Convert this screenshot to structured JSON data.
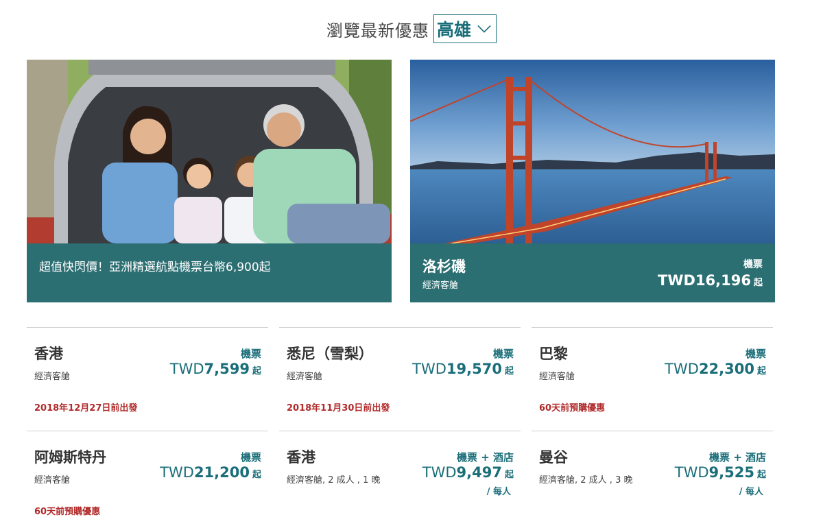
{
  "header": {
    "title": "瀏覽最新優惠",
    "city": "高雄"
  },
  "heroes": [
    {
      "promo": "超值快閃價！亞洲精選航點機票台幣6,900起"
    },
    {
      "destination": "洛杉磯",
      "cabin": "經濟客艙",
      "product": "機票",
      "currency": "TWD",
      "amount": "16,196",
      "from": "起"
    }
  ],
  "cards": [
    {
      "destination": "香港",
      "cabin": "經濟客艙",
      "product": "機票",
      "currency": "TWD",
      "amount": "7,599",
      "from": "起",
      "per": "",
      "note": "2018年12月27日前出發"
    },
    {
      "destination": "悉尼（雪梨）",
      "cabin": "經濟客艙",
      "product": "機票",
      "currency": "TWD",
      "amount": "19,570",
      "from": "起",
      "per": "",
      "note": "2018年11月30日前出發"
    },
    {
      "destination": "巴黎",
      "cabin": "經濟客艙",
      "product": "機票",
      "currency": "TWD",
      "amount": "22,300",
      "from": "起",
      "per": "",
      "note": "60天前預購優惠"
    },
    {
      "destination": "阿姆斯特丹",
      "cabin": "經濟客艙",
      "product": "機票",
      "currency": "TWD",
      "amount": "21,200",
      "from": "起",
      "per": "",
      "note": "60天前預購優惠"
    },
    {
      "destination": "香港",
      "cabin": "經濟客艙, 2 成人 , 1 晚",
      "product": "機票 + 酒店",
      "currency": "TWD",
      "amount": "9,497",
      "from": "起",
      "per": "/ 每人",
      "note": ""
    },
    {
      "destination": "曼谷",
      "cabin": "經濟客艙, 2 成人 , 3 晚",
      "product": "機票 + 酒店",
      "currency": "TWD",
      "amount": "9,525",
      "from": "起",
      "per": "/ 每人",
      "note": ""
    }
  ],
  "colors": {
    "teal": "#1a6e79",
    "band": "#1c6468",
    "note_red": "#b12b2b"
  },
  "icons": {
    "city_dropdown": "chevron-down-icon"
  }
}
